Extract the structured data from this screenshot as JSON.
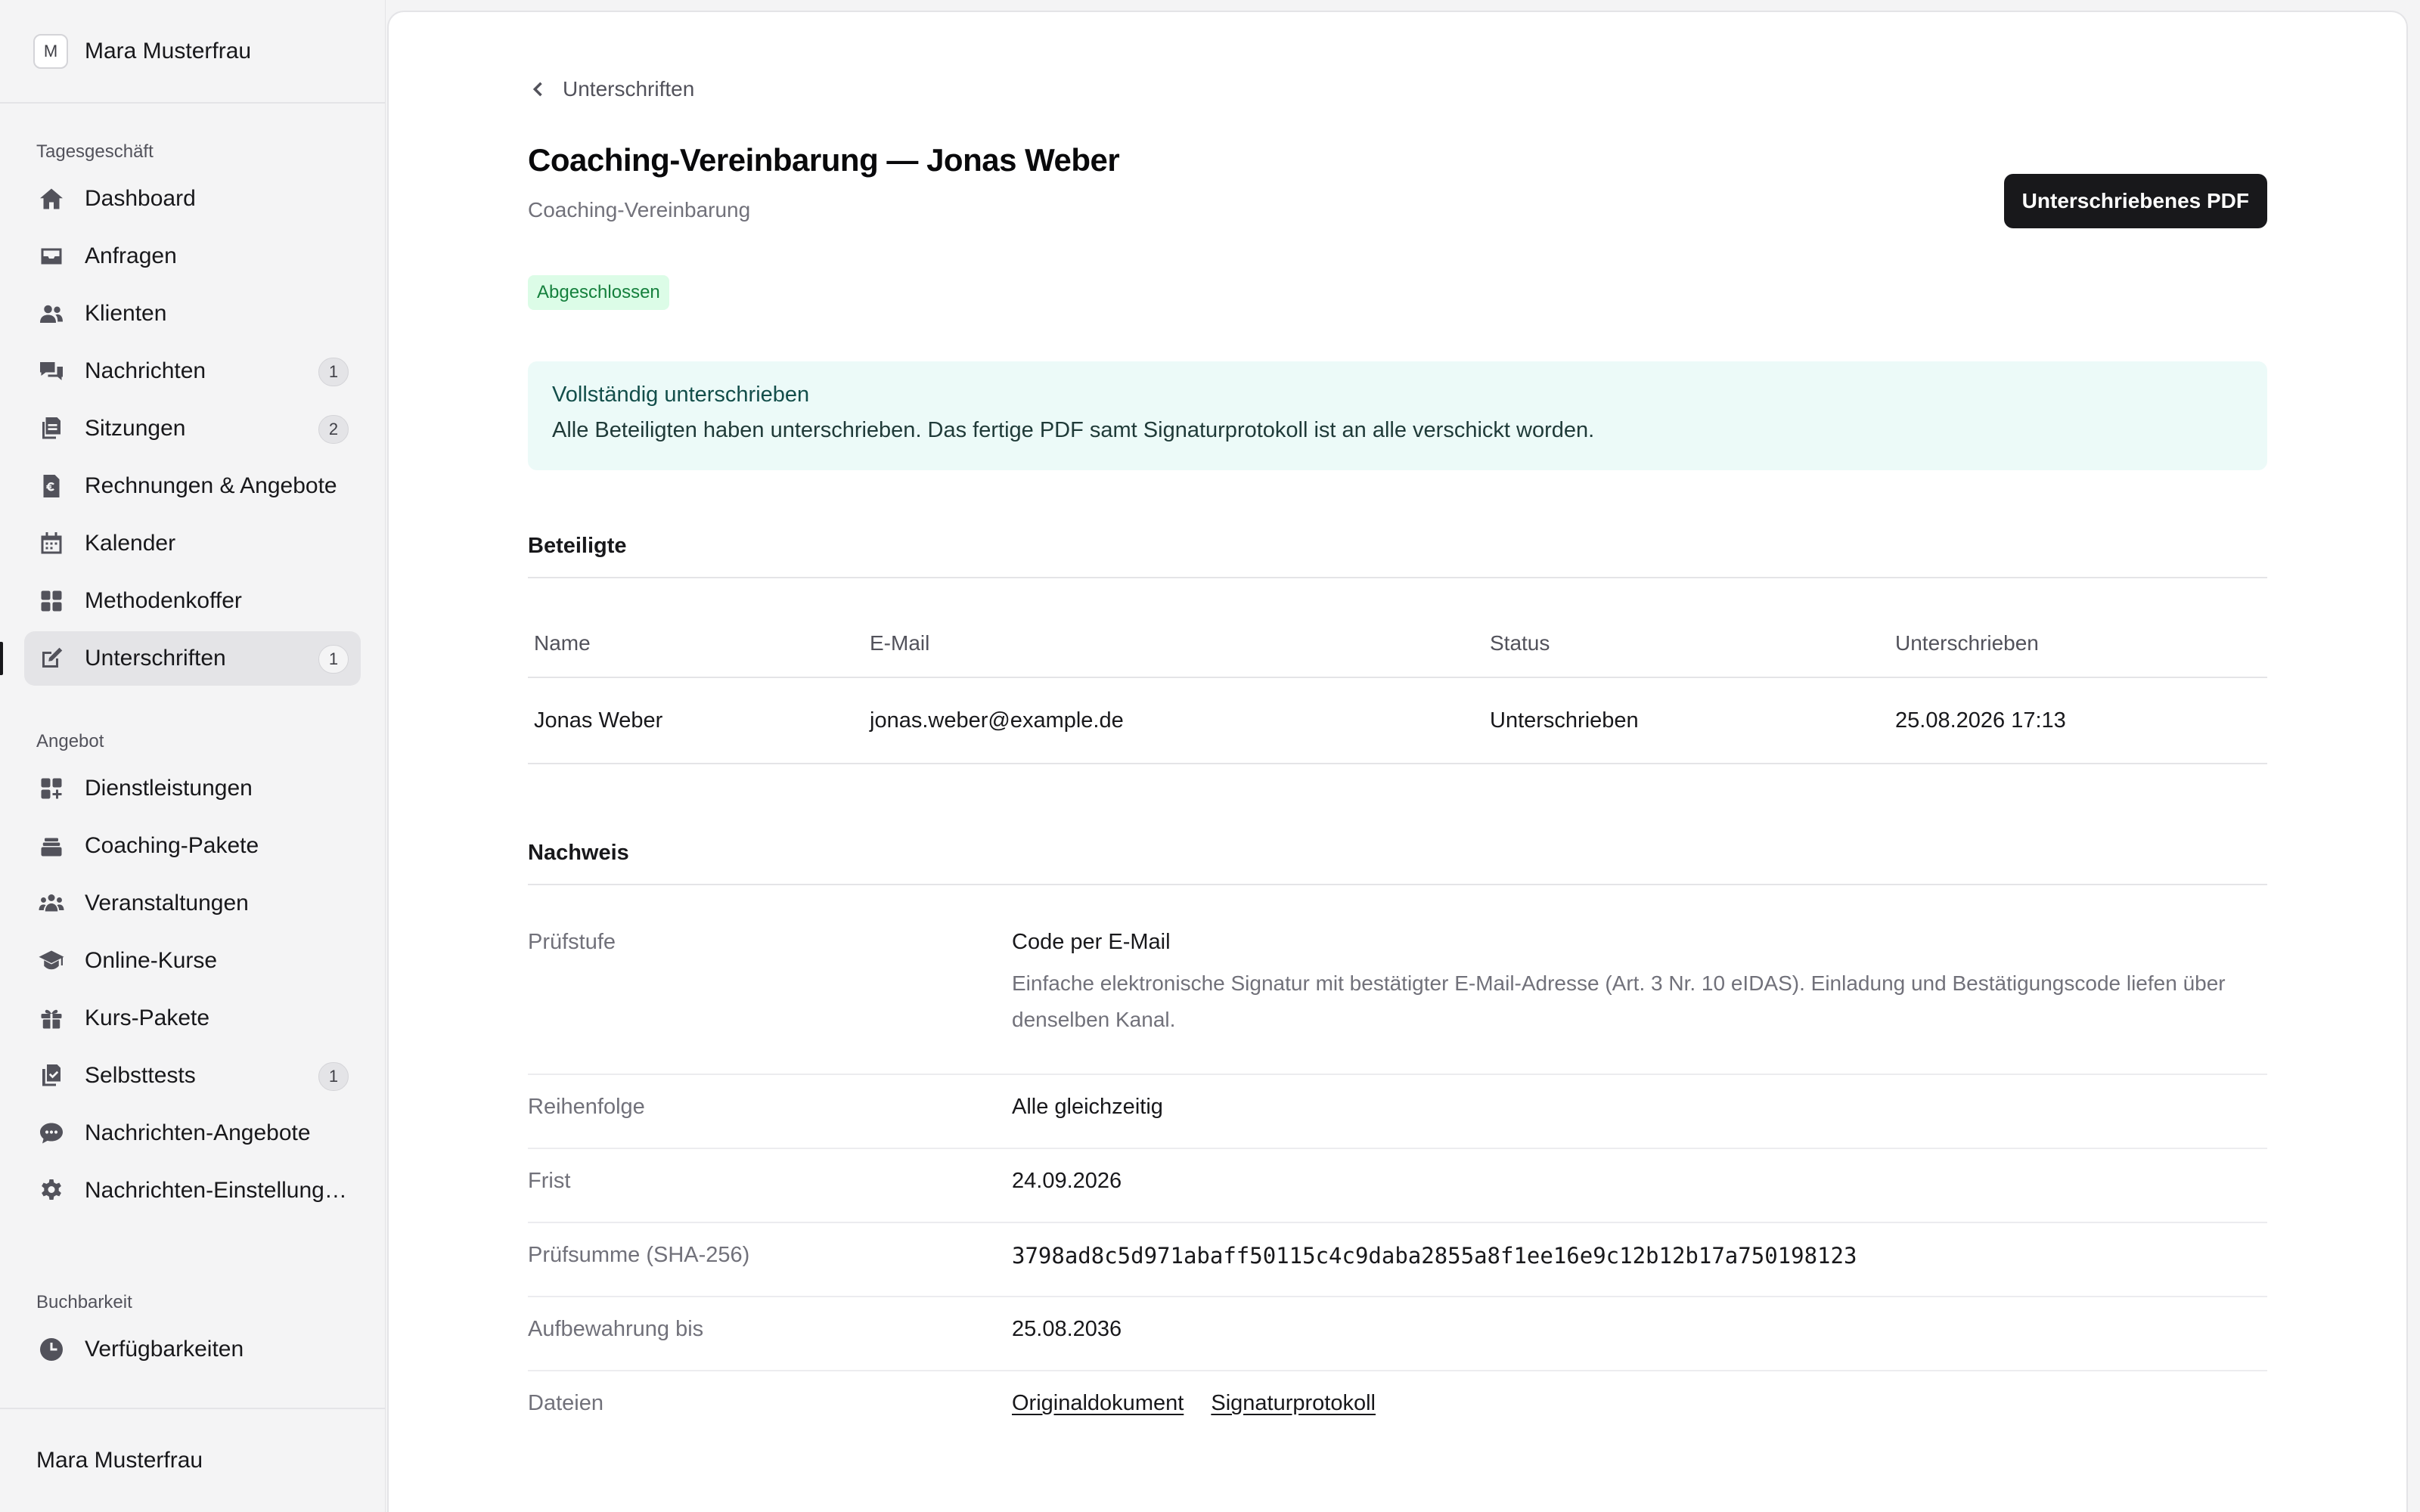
{
  "sidebar": {
    "workspace_initial": "M",
    "workspace_name": "Mara Musterfrau",
    "groups": [
      {
        "label": "Tagesgeschäft",
        "items": [
          {
            "label": "Dashboard",
            "icon": "home-icon"
          },
          {
            "label": "Anfragen",
            "icon": "inbox-icon"
          },
          {
            "label": "Klienten",
            "icon": "users-icon"
          },
          {
            "label": "Nachrichten",
            "icon": "chat-icon",
            "badge": "1"
          },
          {
            "label": "Sitzungen",
            "icon": "documents-icon",
            "badge": "2"
          },
          {
            "label": "Rechnungen & Angebote",
            "icon": "invoice-euro-icon"
          },
          {
            "label": "Kalender",
            "icon": "calendar-icon"
          },
          {
            "label": "Methodenkoffer",
            "icon": "grid-icon"
          },
          {
            "label": "Unterschriften",
            "icon": "signature-edit-icon",
            "badge": "1",
            "active": true
          }
        ]
      },
      {
        "label": "Angebot",
        "items": [
          {
            "label": "Dienstleistungen",
            "icon": "grid-plus-icon"
          },
          {
            "label": "Coaching-Pakete",
            "icon": "stack-icon"
          },
          {
            "label": "Veranstaltungen",
            "icon": "group-icon"
          },
          {
            "label": "Online-Kurse",
            "icon": "graduation-cap-icon"
          },
          {
            "label": "Kurs-Pakete",
            "icon": "gift-icon"
          },
          {
            "label": "Selbsttests",
            "icon": "checklist-icon",
            "badge": "1"
          },
          {
            "label": "Nachrichten-Angebote",
            "icon": "speech-bubble-icon"
          },
          {
            "label": "Nachrichten-Einstellungen",
            "icon": "gear-icon"
          }
        ]
      },
      {
        "label": "Buchbarkeit",
        "items": [
          {
            "label": "Verfügbarkeiten",
            "icon": "clock-icon"
          }
        ]
      }
    ],
    "footer_user": "Mara Musterfrau"
  },
  "page": {
    "back_label": "Unterschriften",
    "title": "Coaching-Vereinbarung — Jonas Weber",
    "subtitle": "Coaching-Vereinbarung",
    "pdf_button": "Unterschriebenes PDF",
    "status": "Abgeschlossen",
    "notice": {
      "title": "Vollständig unterschrieben",
      "text": "Alle Beteiligten haben unterschrieben. Das fertige PDF samt Signaturprotokoll ist an alle verschickt worden."
    }
  },
  "participants": {
    "title": "Beteiligte",
    "columns": [
      "Name",
      "E-Mail",
      "Status",
      "Unterschrieben"
    ],
    "rows": [
      [
        "Jonas Weber",
        "jonas.weber@example.de",
        "Unterschrieben",
        "25.08.2026 17:13"
      ]
    ]
  },
  "proof": {
    "title": "Nachweis",
    "level_label": "Prüfstufe",
    "level_value": "Code per E-Mail",
    "level_desc": "Einfache elektronische Signatur mit bestätigter E-Mail-Adresse (Art. 3 Nr. 10 eIDAS). Einladung und Bestätigungscode liefen über denselben Kanal.",
    "order_label": "Reihenfolge",
    "order_value": "Alle gleichzeitig",
    "deadline_label": "Frist",
    "deadline_value": "24.09.2026",
    "checksum_label": "Prüfsumme (SHA-256)",
    "checksum_value": "3798ad8c5d971abaff50115c4c9daba2855a8f1ee16e9c12b12b17a750198123",
    "retention_label": "Aufbewahrung bis",
    "retention_value": "25.08.2036",
    "files_label": "Dateien",
    "files": [
      "Originaldokument",
      "Signaturprotokoll"
    ]
  }
}
